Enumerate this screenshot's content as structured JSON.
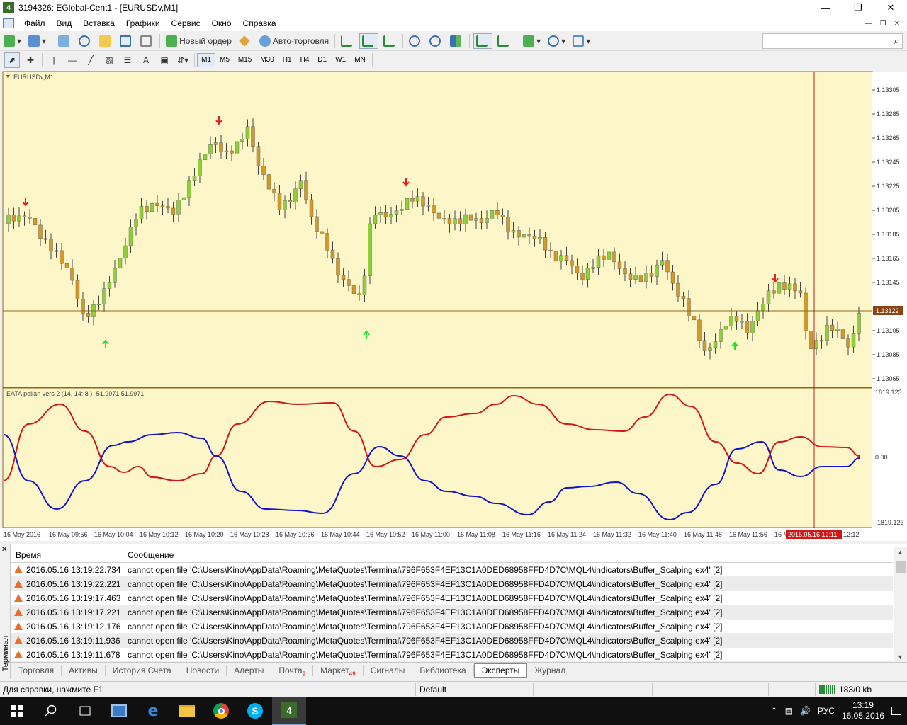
{
  "window": {
    "title": "3194326: EGlobal-Cent1 - [EURUSDv,M1]",
    "app_icon": "metatrader-icon"
  },
  "menu": [
    "Файл",
    "Вид",
    "Вставка",
    "Графики",
    "Сервис",
    "Окно",
    "Справка"
  ],
  "toolbar1": {
    "new_order": "Новый ордер",
    "auto_trading": "Авто-торговля"
  },
  "timeframes": [
    "M1",
    "M5",
    "M15",
    "M30",
    "H1",
    "H4",
    "D1",
    "W1",
    "MN"
  ],
  "active_timeframe": "M1",
  "chart": {
    "symbol_label": "EURUSDv,M1",
    "current_price": "1.13122",
    "price_ticks": [
      "1.13305",
      "1.13285",
      "1.13265",
      "1.13245",
      "1.13225",
      "1.13205",
      "1.13185",
      "1.13165",
      "1.13145",
      "1.13105",
      "1.13085",
      "1.13065"
    ],
    "indicator_label": "EATA pollan vers 2 (14, 14: 8 ) -51.9971 51.9971",
    "indicator_ticks": [
      "1819.123",
      "0.00",
      "-1819.123"
    ],
    "time_labels": [
      "16 May 2016",
      "16 May 09:56",
      "16 May 10:04",
      "16 May 10:12",
      "16 May 10:20",
      "16 May 10:28",
      "16 May 10:36",
      "16 May 10:44",
      "16 May 10:52",
      "16 May 11:00",
      "16 May 11:08",
      "16 May 11:16",
      "16 May 11:24",
      "16 May 11:32",
      "16 May 11:40",
      "16 May 11:48",
      "16 May 11:56",
      "16 M"
    ],
    "cursor_time": "2016.05.16 12:11",
    "last_time_label": "12:12",
    "colors": {
      "background": "#fdf6c8",
      "bull": "#8fcf3c",
      "bear": "#d29a2e",
      "signal_up": "#22dd33",
      "signal_down": "#dd2222",
      "indicator_red": "#d01818",
      "indicator_blue": "#1414c8",
      "grid_line": "#8b6a1a",
      "cursor_line": "#b22222"
    }
  },
  "terminal": {
    "side_label": "Терминал",
    "columns": [
      "Время",
      "Сообщение"
    ],
    "rows": [
      {
        "time": "2016.05.16 13:19:22.734",
        "message": "cannot open file 'C:\\Users\\Kino\\AppData\\Roaming\\MetaQuotes\\Terminal\\796F653F4EF13C1A0DED68958FFD4D7C\\MQL4\\indicators\\Buffer_Scalping.ex4' [2]"
      },
      {
        "time": "2016.05.16 13:19:22.221",
        "message": "cannot open file 'C:\\Users\\Kino\\AppData\\Roaming\\MetaQuotes\\Terminal\\796F653F4EF13C1A0DED68958FFD4D7C\\MQL4\\indicators\\Buffer_Scalping.ex4' [2]"
      },
      {
        "time": "2016.05.16 13:19:17.463",
        "message": "cannot open file 'C:\\Users\\Kino\\AppData\\Roaming\\MetaQuotes\\Terminal\\796F653F4EF13C1A0DED68958FFD4D7C\\MQL4\\indicators\\Buffer_Scalping.ex4' [2]"
      },
      {
        "time": "2016.05.16 13:19:17.221",
        "message": "cannot open file 'C:\\Users\\Kino\\AppData\\Roaming\\MetaQuotes\\Terminal\\796F653F4EF13C1A0DED68958FFD4D7C\\MQL4\\indicators\\Buffer_Scalping.ex4' [2]"
      },
      {
        "time": "2016.05.16 13:19:12.176",
        "message": "cannot open file 'C:\\Users\\Kino\\AppData\\Roaming\\MetaQuotes\\Terminal\\796F653F4EF13C1A0DED68958FFD4D7C\\MQL4\\indicators\\Buffer_Scalping.ex4' [2]"
      },
      {
        "time": "2016.05.16 13:19:11.936",
        "message": "cannot open file 'C:\\Users\\Kino\\AppData\\Roaming\\MetaQuotes\\Terminal\\796F653F4EF13C1A0DED68958FFD4D7C\\MQL4\\indicators\\Buffer_Scalping.ex4' [2]"
      },
      {
        "time": "2016.05.16 13:19:11.678",
        "message": "cannot open file 'C:\\Users\\Kino\\AppData\\Roaming\\MetaQuotes\\Terminal\\796F653F4EF13C1A0DED68958FFD4D7C\\MQL4\\indicators\\Buffer_Scalping.ex4' [2]"
      }
    ],
    "tabs": [
      {
        "label": "Торговля",
        "badge": ""
      },
      {
        "label": "Активы",
        "badge": ""
      },
      {
        "label": "История Счета",
        "badge": ""
      },
      {
        "label": "Новости",
        "badge": ""
      },
      {
        "label": "Алерты",
        "badge": ""
      },
      {
        "label": "Почта",
        "badge": "9"
      },
      {
        "label": "Маркет",
        "badge": "49"
      },
      {
        "label": "Сигналы",
        "badge": ""
      },
      {
        "label": "Библиотека",
        "badge": ""
      },
      {
        "label": "Эксперты",
        "badge": ""
      },
      {
        "label": "Журнал",
        "badge": ""
      }
    ],
    "active_tab": "Эксперты"
  },
  "statusbar": {
    "help": "Для справки, нажмите F1",
    "profile": "Default",
    "traffic": "183/0 kb"
  },
  "taskbar": {
    "language": "РУС",
    "time": "13:19",
    "date": "16.05.2016"
  }
}
